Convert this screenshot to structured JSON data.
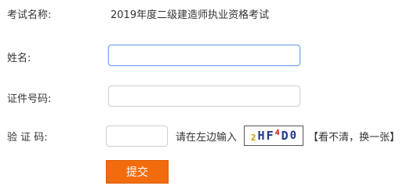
{
  "form": {
    "exam_label": "考试名称:",
    "exam_value": "2019年度二级建造师执业资格考试",
    "name_label": "姓名:",
    "name_value": "",
    "id_label": "证件号码:",
    "id_value": "",
    "captcha_label": "验 证 码:",
    "captcha_value": "",
    "captcha_hint": "请在左边输入",
    "captcha_chars": [
      {
        "ch": "2",
        "color": "#c99a00"
      },
      {
        "ch": "H",
        "color": "#1f3a8a"
      },
      {
        "ch": "F",
        "color": "#1f3a8a"
      },
      {
        "ch": "4",
        "color": "#d01010"
      },
      {
        "ch": "D",
        "color": "#1f3a8a"
      },
      {
        "ch": "0",
        "color": "#1f3a8a"
      }
    ],
    "refresh_link": "【看不清，换一张】",
    "submit_label": "提交"
  },
  "colors": {
    "submit_bg": "#f26c0d",
    "focus_border": "#7aa7e8"
  }
}
